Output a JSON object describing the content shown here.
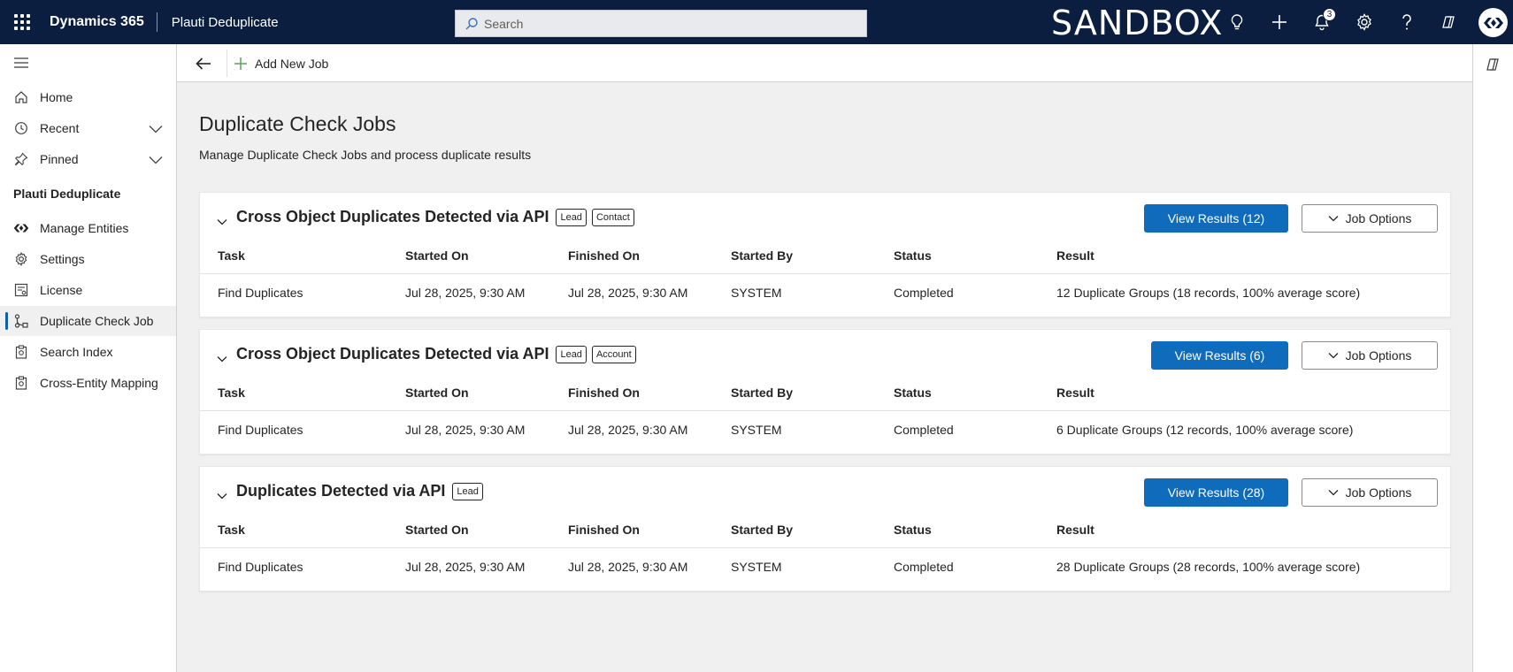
{
  "topbar": {
    "brand": "Dynamics 365",
    "app_name": "Plauti Deduplicate",
    "search_placeholder": "Search",
    "environment": "SANDBOX",
    "notifications_count": "3"
  },
  "sidebar": {
    "items": [
      {
        "label": "Home",
        "icon": "home-icon"
      },
      {
        "label": "Recent",
        "icon": "clock-icon"
      },
      {
        "label": "Pinned",
        "icon": "pin-icon"
      }
    ],
    "section_title": "Plauti Deduplicate",
    "section_items": [
      {
        "label": "Manage Entities",
        "icon": "plauti-logo-icon"
      },
      {
        "label": "Settings",
        "icon": "gear-icon"
      },
      {
        "label": "License",
        "icon": "license-icon"
      },
      {
        "label": "Duplicate Check Job",
        "icon": "job-flow-icon",
        "active": true
      },
      {
        "label": "Search Index",
        "icon": "clipboard-icon"
      },
      {
        "label": "Cross-Entity Mapping",
        "icon": "clipboard-icon"
      }
    ]
  },
  "command_bar": {
    "add_job_label": "Add New Job"
  },
  "page": {
    "title": "Duplicate Check Jobs",
    "subtitle": "Manage Duplicate Check Jobs and process duplicate results"
  },
  "table_headers": [
    "Task",
    "Started On",
    "Finished On",
    "Started By",
    "Status",
    "Result"
  ],
  "jobs": [
    {
      "title": "Cross Object Duplicates Detected via API",
      "tags": [
        "Lead",
        "Contact"
      ],
      "view_results_label": "View Results (12)",
      "job_options_label": "Job Options",
      "row": [
        "Find Duplicates",
        "Jul 28, 2025, 9:30 AM",
        "Jul 28, 2025, 9:30 AM",
        "SYSTEM",
        "Completed",
        "12 Duplicate Groups (18 records, 100% average score)"
      ]
    },
    {
      "title": "Cross Object Duplicates Detected via API",
      "tags": [
        "Lead",
        "Account"
      ],
      "view_results_label": "View Results (6)",
      "job_options_label": "Job Options",
      "row": [
        "Find Duplicates",
        "Jul 28, 2025, 9:30 AM",
        "Jul 28, 2025, 9:30 AM",
        "SYSTEM",
        "Completed",
        "6 Duplicate Groups (12 records, 100% average score)"
      ]
    },
    {
      "title": "Duplicates Detected via API",
      "tags": [
        "Lead"
      ],
      "view_results_label": "View Results (28)",
      "job_options_label": "Job Options",
      "row": [
        "Find Duplicates",
        "Jul 28, 2025, 9:30 AM",
        "Jul 28, 2025, 9:30 AM",
        "SYSTEM",
        "Completed",
        "28 Duplicate Groups (28 records, 100% average score)"
      ]
    }
  ],
  "colors": {
    "topbar": "#0b1e3f",
    "primary_button": "#0f6cbd",
    "active_indicator": "#115ea3",
    "add_icon": "#107c10"
  }
}
